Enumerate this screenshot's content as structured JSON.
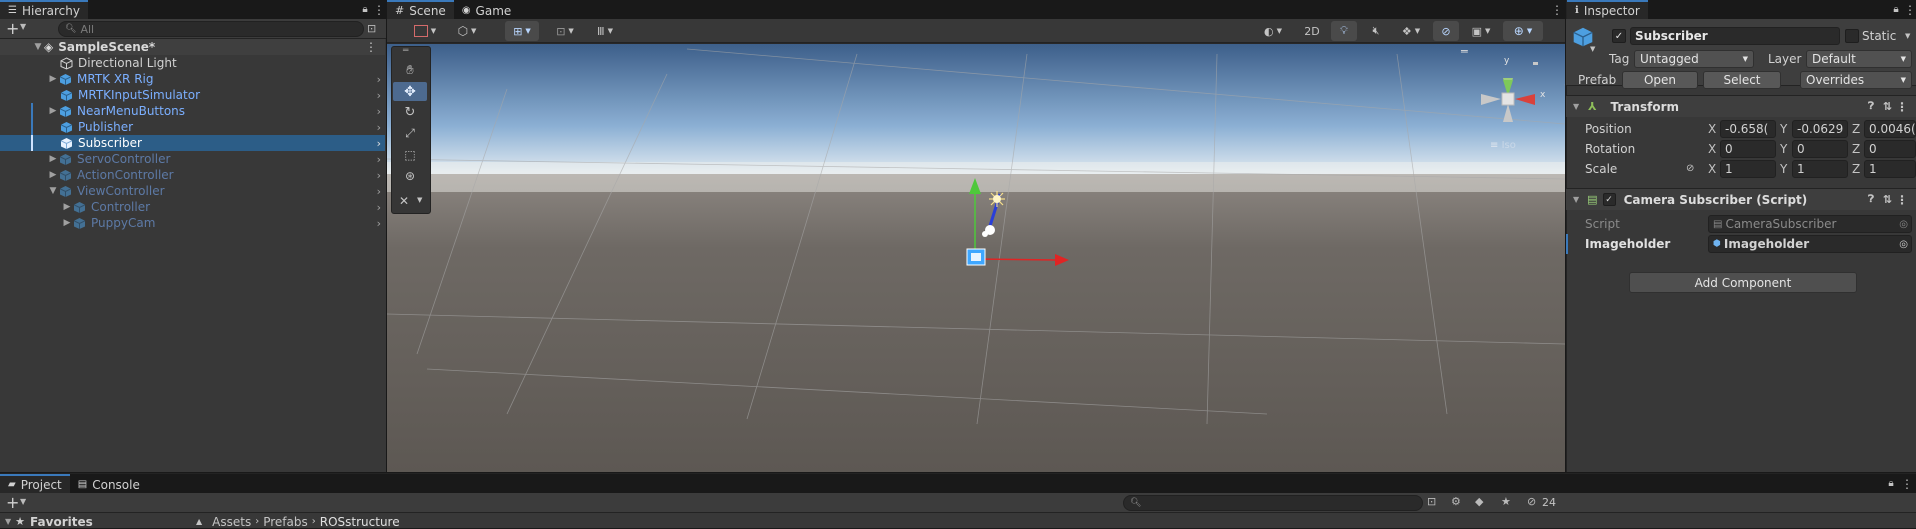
{
  "hierarchy": {
    "tab_label": "Hierarchy",
    "search_placeholder": "All",
    "scene_name": "SampleScene*",
    "items": [
      {
        "label": "Directional Light"
      },
      {
        "label": "MRTK XR Rig"
      },
      {
        "label": "MRTKInputSimulator"
      },
      {
        "label": "NearMenuButtons"
      },
      {
        "label": "Publisher"
      },
      {
        "label": "Subscriber"
      },
      {
        "label": "ServoController"
      },
      {
        "label": "ActionController"
      },
      {
        "label": "ViewController"
      },
      {
        "label": "Controller"
      },
      {
        "label": "PuppyCam"
      }
    ]
  },
  "scene": {
    "tab_scene": "Scene",
    "tab_game": "Game",
    "btn_2d": "2D",
    "persp_label": "Iso",
    "gizmo_y": "y",
    "gizmo_x": "x"
  },
  "inspector": {
    "tab_label": "Inspector",
    "object_name": "Subscriber",
    "static_label": "Static",
    "tag_label": "Tag",
    "tag_value": "Untagged",
    "layer_label": "Layer",
    "layer_value": "Default",
    "prefab_label": "Prefab",
    "prefab_open": "Open",
    "prefab_select": "Select",
    "prefab_overrides": "Overrides",
    "transform_title": "Transform",
    "position_label": "Position",
    "rotation_label": "Rotation",
    "scale_label": "Scale",
    "axis_x": "X",
    "axis_y": "Y",
    "axis_z": "Z",
    "position": {
      "x": "-0.658(",
      "y": "-0.0629",
      "z": "0.0046("
    },
    "rotation": {
      "x": "0",
      "y": "0",
      "z": "0"
    },
    "scale": {
      "x": "1",
      "y": "1",
      "z": "1"
    },
    "script_component_title": "Camera Subscriber (Script)",
    "script_label": "Script",
    "script_value": "CameraSubscriber",
    "imageholder_label": "Imageholder",
    "imageholder_value": "Imageholder",
    "add_component": "Add Component"
  },
  "bottom": {
    "tab_project": "Project",
    "tab_console": "Console",
    "favorites": "Favorites",
    "breadcrumb": [
      "Assets",
      "Prefabs",
      "ROSstructure"
    ],
    "hidden_count": "24"
  },
  "colors": {
    "selection": "#2c5d87",
    "accent_blue": "#3a79bb",
    "prefab_text": "#7bafff",
    "panel_bg": "#383838"
  }
}
